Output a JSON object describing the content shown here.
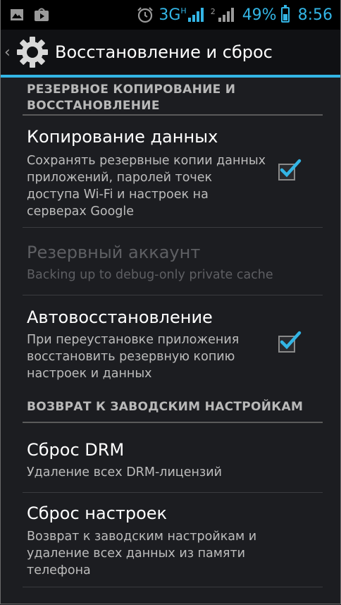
{
  "status_bar": {
    "network_type": "3G",
    "network_sub": "H",
    "sim2_label": "2",
    "battery_percent": "49%",
    "time": "8:56",
    "icons": [
      "image-icon",
      "play-store-icon",
      "alarm-icon",
      "signal-icon",
      "signal-2-icon",
      "battery-icon"
    ],
    "accent_color": "#33b5e5",
    "battery_level": 0.49
  },
  "action_bar": {
    "title": "Восстановление и сброс",
    "icon": "settings-gear-icon"
  },
  "sections": {
    "backup": {
      "header": "РЕЗЕРВНОЕ КОПИРОВАНИЕ И ВОССТАНОВЛЕНИЕ",
      "items": [
        {
          "title": "Копирование данных",
          "summary": "Сохранять резервные копии данных приложений, паролей точек доступа Wi-Fi и настроек на серверах Google",
          "checked": true
        },
        {
          "title": "Резервный аккаунт",
          "summary": "Backing up to debug-only private cache",
          "enabled": false
        },
        {
          "title": "Автовосстановление",
          "summary": "При переустановке приложения восстановить резервную копию настроек и данных",
          "checked": true
        }
      ]
    },
    "factory": {
      "header": "ВОЗВРАТ К ЗАВОДСКИМ НАСТРОЙКАМ",
      "items": [
        {
          "title": "Сброс DRM",
          "summary": "Удаление всех DRM-лицензий"
        },
        {
          "title": "Сброс настроек",
          "summary": "Возврат к заводским настройкам и удаление всех данных из памяти телефона"
        }
      ]
    }
  }
}
